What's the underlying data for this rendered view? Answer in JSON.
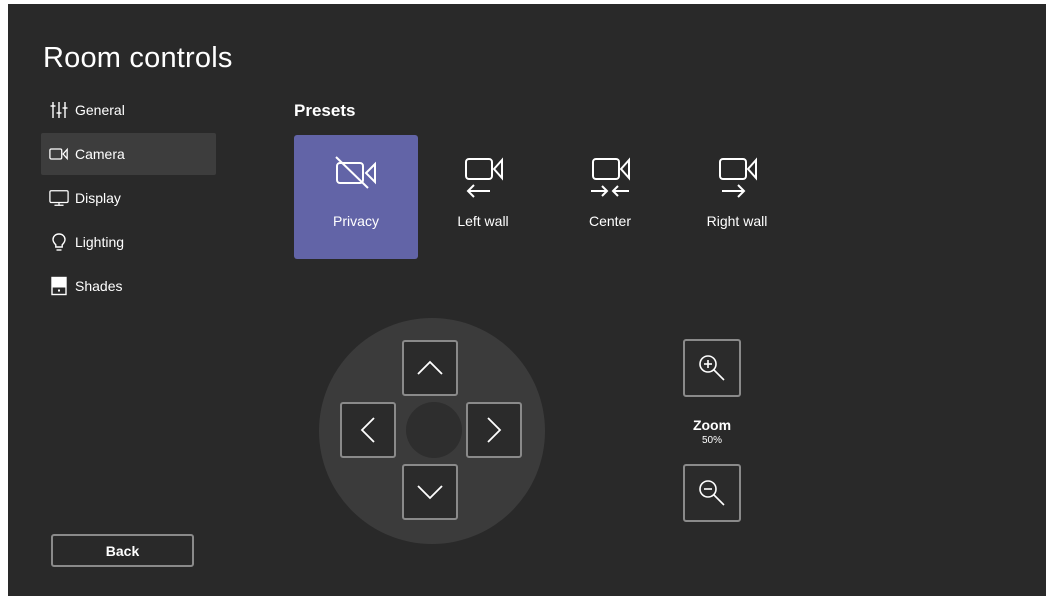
{
  "page": {
    "title": "Room controls"
  },
  "sidebar": {
    "items": [
      {
        "label": "General",
        "icon": "sliders-icon",
        "active": false
      },
      {
        "label": "Camera",
        "icon": "camera-icon",
        "active": true
      },
      {
        "label": "Display",
        "icon": "monitor-icon",
        "active": false
      },
      {
        "label": "Lighting",
        "icon": "lightbulb-icon",
        "active": false
      },
      {
        "label": "Shades",
        "icon": "shades-icon",
        "active": false
      }
    ],
    "back_label": "Back"
  },
  "presets": {
    "title": "Presets",
    "items": [
      {
        "label": "Privacy",
        "icon": "camera-off-icon",
        "active": true
      },
      {
        "label": "Left wall",
        "icon": "camera-left-icon",
        "active": false
      },
      {
        "label": "Center",
        "icon": "camera-center-icon",
        "active": false
      },
      {
        "label": "Right wall",
        "icon": "camera-right-icon",
        "active": false
      }
    ]
  },
  "zoom": {
    "label": "Zoom",
    "value": "50%"
  },
  "colors": {
    "background": "#292929",
    "accent": "#6264a7",
    "active_nav": "#3d3d3d",
    "border": "#8a8a8a"
  }
}
